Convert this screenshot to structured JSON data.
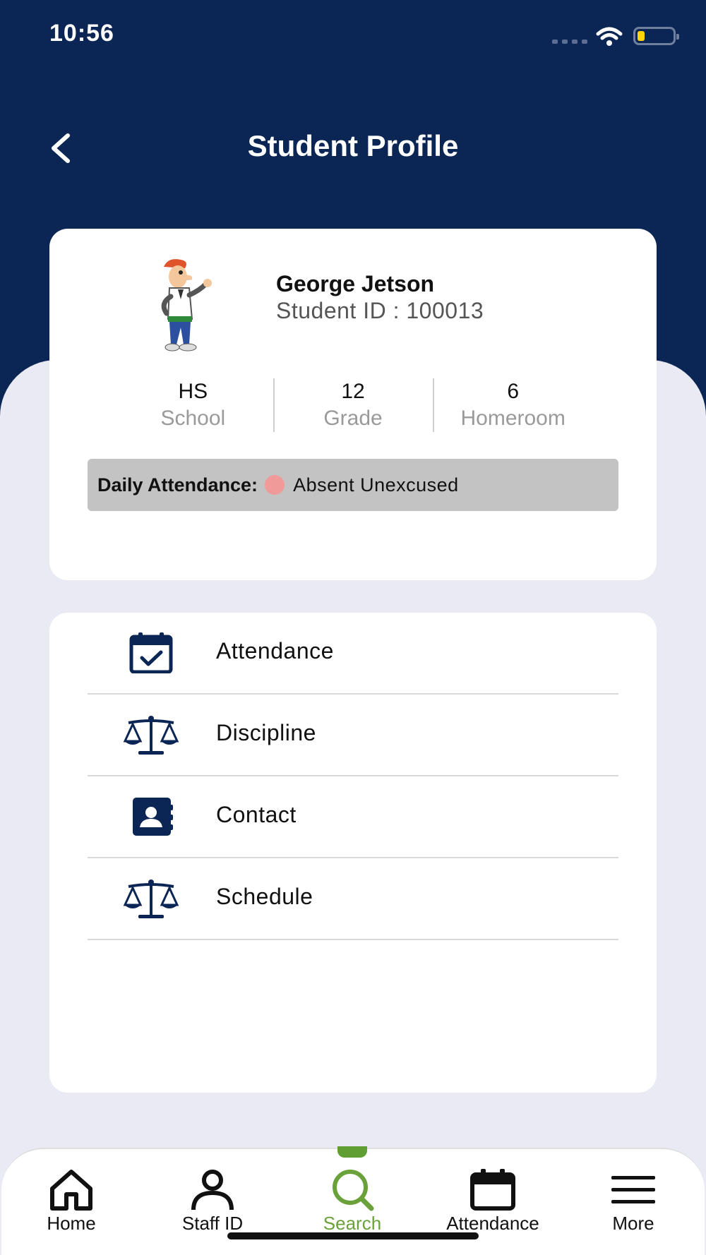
{
  "status_bar": {
    "time": "10:56"
  },
  "header": {
    "title": "Student Profile"
  },
  "profile": {
    "name": "George Jetson",
    "student_id": "Student ID : 100013",
    "stats": [
      {
        "value": "HS",
        "label": "School"
      },
      {
        "value": "12",
        "label": "Grade"
      },
      {
        "value": "6",
        "label": "Homeroom"
      }
    ],
    "attendance": {
      "label": "Daily Attendance:",
      "status": "Absent Unexcused",
      "status_color": "#f09a9a"
    }
  },
  "menu": {
    "items": [
      {
        "label": "Attendance",
        "icon": "calendar-check-icon"
      },
      {
        "label": "Discipline",
        "icon": "scale-icon"
      },
      {
        "label": "Contact",
        "icon": "contact-book-icon"
      },
      {
        "label": "Schedule",
        "icon": "scale-icon"
      }
    ]
  },
  "bottom_nav": {
    "items": [
      {
        "label": "Home",
        "icon": "home-icon"
      },
      {
        "label": "Staff ID",
        "icon": "person-icon"
      },
      {
        "label": "Search",
        "icon": "search-icon",
        "active": true
      },
      {
        "label": "Attendance",
        "icon": "calendar-icon"
      },
      {
        "label": "More",
        "icon": "menu-icon"
      }
    ]
  },
  "colors": {
    "navy": "#0b2654",
    "accent_green": "#6aa13a",
    "background": "#eaeaf4"
  }
}
